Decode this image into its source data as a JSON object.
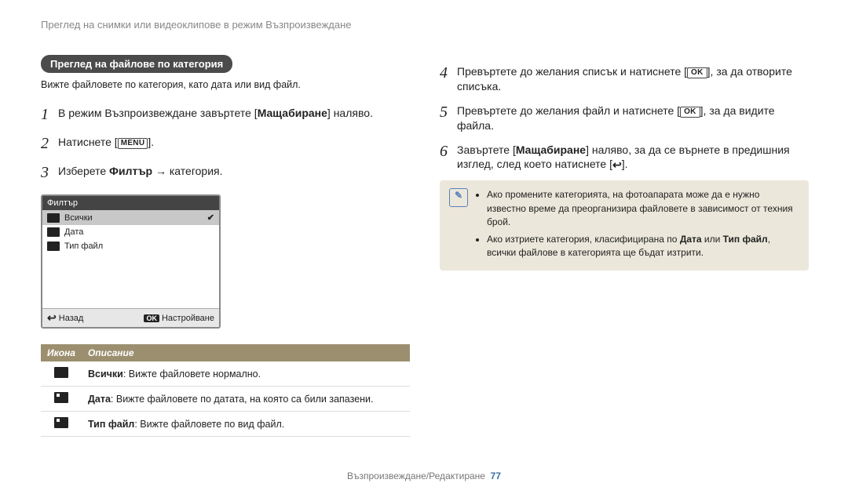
{
  "header": {
    "breadcrumb": "Преглед на снимки или видеоклипове в режим Възпроизвеждане"
  },
  "section": {
    "title": "Преглед на файлове по категория",
    "subtitle": "Вижте файловете по категория, като дата или вид файл."
  },
  "glyphs": {
    "menu": "MENU",
    "ok": "OK",
    "back": "↩"
  },
  "steps": [
    {
      "n": "1",
      "pre": "В режим Възпроизвеждане завъртете [",
      "bold": "Мащабиране",
      "post": "] наляво."
    },
    {
      "n": "2",
      "pre": "Натиснете [",
      "glyph": "menu",
      "post": "]."
    },
    {
      "n": "3",
      "pre": "Изберете ",
      "bold": "Филтър",
      "post": " → категория."
    },
    {
      "n": "4",
      "pre": "Превъртете до желания списък и натиснете [",
      "glyph": "ok",
      "post": "], за да отворите списъка."
    },
    {
      "n": "5",
      "pre": "Превъртете до желания файл и натиснете [",
      "glyph": "ok",
      "post": "], за да видите файла."
    },
    {
      "n": "6",
      "pre": "Завъртете [",
      "bold": "Мащабиране",
      "mid": "] наляво, за да се върнете в предишния изглед, след което натиснете [",
      "glyph": "back",
      "post": "]."
    }
  ],
  "ui": {
    "title": "Филтър",
    "items": [
      {
        "label": "Всички",
        "selected": true
      },
      {
        "label": "Дата",
        "selected": false
      },
      {
        "label": "Тип файл",
        "selected": false
      }
    ],
    "footer_left_icon": "↩",
    "footer_left": "Назад",
    "footer_right_icon": "OK",
    "footer_right": "Настройване"
  },
  "table": {
    "head_icon": "Икона",
    "head_desc": "Описание",
    "rows": [
      {
        "bold": "Всички",
        "desc": ": Вижте файловете нормално."
      },
      {
        "bold": "Дата",
        "desc": ": Вижте файловете по датата, на която са били запазени."
      },
      {
        "bold": "Тип файл",
        "desc": ": Вижте файловете по вид файл."
      }
    ]
  },
  "note": {
    "badge": "✎",
    "bullet1_pre": "Ако промените категорията, на фотоапарата може да е нужно известно време да преорганизира файловете в зависимост от техния брой.",
    "bullet2_pre": "Ако изтриете категория, класифицирана по ",
    "bullet2_b1": "Дата",
    "bullet2_mid": " или ",
    "bullet2_b2": "Тип файл",
    "bullet2_post": ", всички файлове в категорията ще бъдат изтрити."
  },
  "footer": {
    "text": "Възпроизвеждане/Редактиране",
    "page": "77"
  }
}
